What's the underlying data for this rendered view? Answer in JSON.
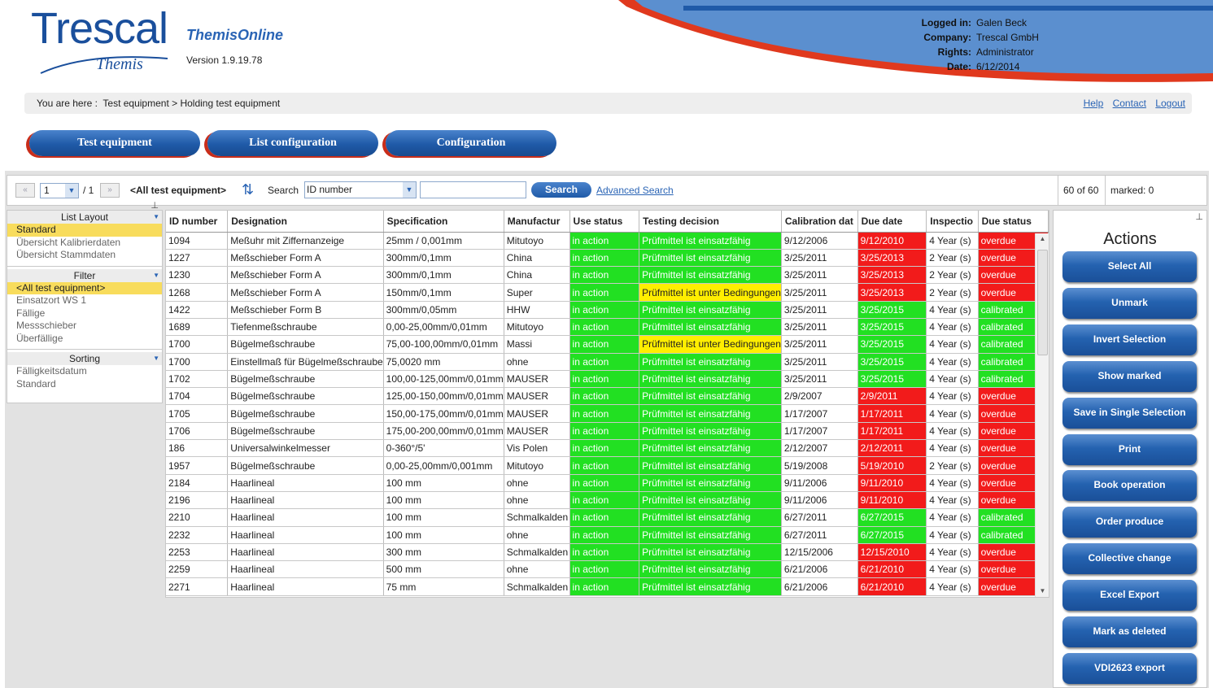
{
  "header": {
    "logo_text": "Trescal",
    "logo_sub": "Themis",
    "app_name": "ThemisOnline",
    "version": "Version 1.9.19.78",
    "user": [
      {
        "key": "Logged in:",
        "value": "Galen Beck"
      },
      {
        "key": "Company:",
        "value": "Trescal GmbH"
      },
      {
        "key": "Rights:",
        "value": "Administrator"
      },
      {
        "key": "Date:",
        "value": "6/12/2014"
      }
    ],
    "accent_color": "#e0391e",
    "brand_color": "#1a4f9c"
  },
  "breadcrumb": {
    "prefix": "You are here :",
    "path": "Test equipment > Holding test equipment"
  },
  "top_links": {
    "help": "Help",
    "contact": "Contact",
    "logout": "Logout"
  },
  "nav": {
    "test_equipment": "Test equipment",
    "list_configuration": "List configuration",
    "configuration": "Configuration"
  },
  "toolbar": {
    "first": "«",
    "prev": "»",
    "page": "1",
    "page_total": "/ 1",
    "view": "<All test equipment>",
    "search_label": "Search",
    "search_field": "ID number",
    "search_value": "",
    "search_button": "Search",
    "advanced_search": "Advanced Search",
    "count": "60 of 60",
    "marked": "marked: 0"
  },
  "left_panel": {
    "list_layout": {
      "title": "List Layout",
      "items": [
        "Standard",
        "Übersicht Kalibrierdaten",
        "Übersicht Stammdaten"
      ]
    },
    "filter": {
      "title": "Filter",
      "items": [
        "<All test equipment>",
        "Einsatzort WS 1",
        "Fällige",
        "Messschieber",
        "Überfällige"
      ]
    },
    "sorting": {
      "title": "Sorting",
      "items": [
        "Fälligkeitsdatum",
        "Standard"
      ]
    }
  },
  "table": {
    "columns": [
      "ID number",
      "Designation",
      "Specification",
      "Manufactur",
      "Use status",
      "Testing decision",
      "Calibration dat",
      "Due date",
      "Inspectio",
      "Due status"
    ],
    "rows": [
      [
        "1094",
        "Meßuhr mit Ziffernanzeige",
        "25mm / 0,001mm",
        "Mitutoyo",
        "in action",
        "Prüfmittel ist einsatzfähig",
        "9/12/2006",
        "9/12/2010",
        "4 Year (s)",
        "overdue",
        "ok",
        "red"
      ],
      [
        "1227",
        "Meßschieber Form A",
        "300mm/0,1mm",
        "China",
        "in action",
        "Prüfmittel ist einsatzfähig",
        "3/25/2011",
        "3/25/2013",
        "2 Year (s)",
        "overdue",
        "ok",
        "red"
      ],
      [
        "1230",
        "Meßschieber Form A",
        "300mm/0,1mm",
        "China",
        "in action",
        "Prüfmittel ist einsatzfähig",
        "3/25/2011",
        "3/25/2013",
        "2 Year (s)",
        "overdue",
        "ok",
        "red"
      ],
      [
        "1268",
        "Meßschieber Form A",
        "150mm/0,1mm",
        "Super",
        "in action",
        "Prüfmittel ist unter Bedingungen",
        "3/25/2011",
        "3/25/2013",
        "2 Year (s)",
        "overdue",
        "warn",
        "red"
      ],
      [
        "1422",
        "Meßschieber Form B",
        "300mm/0,05mm",
        "HHW",
        "in action",
        "Prüfmittel ist einsatzfähig",
        "3/25/2011",
        "3/25/2015",
        "4 Year (s)",
        "calibrated",
        "ok",
        "green"
      ],
      [
        "1689",
        "Tiefenmeßschraube",
        "0,00-25,00mm/0,01mm",
        "Mitutoyo",
        "in action",
        "Prüfmittel ist einsatzfähig",
        "3/25/2011",
        "3/25/2015",
        "4 Year (s)",
        "calibrated",
        "ok",
        "green"
      ],
      [
        "1700",
        "Bügelmeßschraube",
        "75,00-100,00mm/0,01mm",
        "Massi",
        "in action",
        "Prüfmittel ist unter Bedingungen",
        "3/25/2011",
        "3/25/2015",
        "4 Year (s)",
        "calibrated",
        "warn",
        "green"
      ],
      [
        "1700",
        "Einstellmaß für Bügelmeßschraube",
        "75,0020 mm",
        "ohne",
        "in action",
        "Prüfmittel ist einsatzfähig",
        "3/25/2011",
        "3/25/2015",
        "4 Year (s)",
        "calibrated",
        "ok",
        "green"
      ],
      [
        "1702",
        "Bügelmeßschraube",
        "100,00-125,00mm/0,01mm",
        "MAUSER",
        "in action",
        "Prüfmittel ist einsatzfähig",
        "3/25/2011",
        "3/25/2015",
        "4 Year (s)",
        "calibrated",
        "ok",
        "green"
      ],
      [
        "1704",
        "Bügelmeßschraube",
        "125,00-150,00mm/0,01mm",
        "MAUSER",
        "in action",
        "Prüfmittel ist einsatzfähig",
        "2/9/2007",
        "2/9/2011",
        "4 Year (s)",
        "overdue",
        "ok",
        "red"
      ],
      [
        "1705",
        "Bügelmeßschraube",
        "150,00-175,00mm/0,01mm",
        "MAUSER",
        "in action",
        "Prüfmittel ist einsatzfähig",
        "1/17/2007",
        "1/17/2011",
        "4 Year (s)",
        "overdue",
        "ok",
        "red"
      ],
      [
        "1706",
        "Bügelmeßschraube",
        "175,00-200,00mm/0,01mm",
        "MAUSER",
        "in action",
        "Prüfmittel ist einsatzfähig",
        "1/17/2007",
        "1/17/2011",
        "4 Year (s)",
        "overdue",
        "ok",
        "red"
      ],
      [
        "186",
        "Universalwinkelmesser",
        "0-360°/5'",
        "Vis Polen",
        "in action",
        "Prüfmittel ist einsatzfähig",
        "2/12/2007",
        "2/12/2011",
        "4 Year (s)",
        "overdue",
        "ok",
        "red"
      ],
      [
        "1957",
        "Bügelmeßschraube",
        "0,00-25,00mm/0,001mm",
        "Mitutoyo",
        "in action",
        "Prüfmittel ist einsatzfähig",
        "5/19/2008",
        "5/19/2010",
        "2 Year (s)",
        "overdue",
        "ok",
        "red"
      ],
      [
        "2184",
        "Haarlineal",
        "100 mm",
        "ohne",
        "in action",
        "Prüfmittel ist einsatzfähig",
        "9/11/2006",
        "9/11/2010",
        "4 Year (s)",
        "overdue",
        "ok",
        "red"
      ],
      [
        "2196",
        "Haarlineal",
        "100 mm",
        "ohne",
        "in action",
        "Prüfmittel ist einsatzfähig",
        "9/11/2006",
        "9/11/2010",
        "4 Year (s)",
        "overdue",
        "ok",
        "red"
      ],
      [
        "2210",
        "Haarlineal",
        "100 mm",
        "Schmalkalden",
        "in action",
        "Prüfmittel ist einsatzfähig",
        "6/27/2011",
        "6/27/2015",
        "4 Year (s)",
        "calibrated",
        "ok",
        "green"
      ],
      [
        "2232",
        "Haarlineal",
        "100 mm",
        "ohne",
        "in action",
        "Prüfmittel ist einsatzfähig",
        "6/27/2011",
        "6/27/2015",
        "4 Year (s)",
        "calibrated",
        "ok",
        "green"
      ],
      [
        "2253",
        "Haarlineal",
        "300 mm",
        "Schmalkalden",
        "in action",
        "Prüfmittel ist einsatzfähig",
        "12/15/2006",
        "12/15/2010",
        "4 Year (s)",
        "overdue",
        "ok",
        "red"
      ],
      [
        "2259",
        "Haarlineal",
        "500 mm",
        "ohne",
        "in action",
        "Prüfmittel ist einsatzfähig",
        "6/21/2006",
        "6/21/2010",
        "4 Year (s)",
        "overdue",
        "ok",
        "red"
      ],
      [
        "2271",
        "Haarlineal",
        "75 mm",
        "Schmalkalden",
        "in action",
        "Prüfmittel ist einsatzfähig",
        "6/21/2006",
        "6/21/2010",
        "4 Year (s)",
        "overdue",
        "ok",
        "red"
      ]
    ]
  },
  "actions": {
    "title": "Actions",
    "buttons": [
      "Select All",
      "Unmark",
      "Invert Selection",
      "Show marked",
      "Save in Single Selection",
      "Print",
      "Book operation",
      "Order produce",
      "Collective change",
      "Excel Export",
      "Mark as deleted",
      "VDI2623 export"
    ]
  },
  "colors": {
    "green": "#22e022",
    "red": "#f21b1b",
    "yellow": "#ffee00",
    "button_blue": "#1f5aa8"
  }
}
